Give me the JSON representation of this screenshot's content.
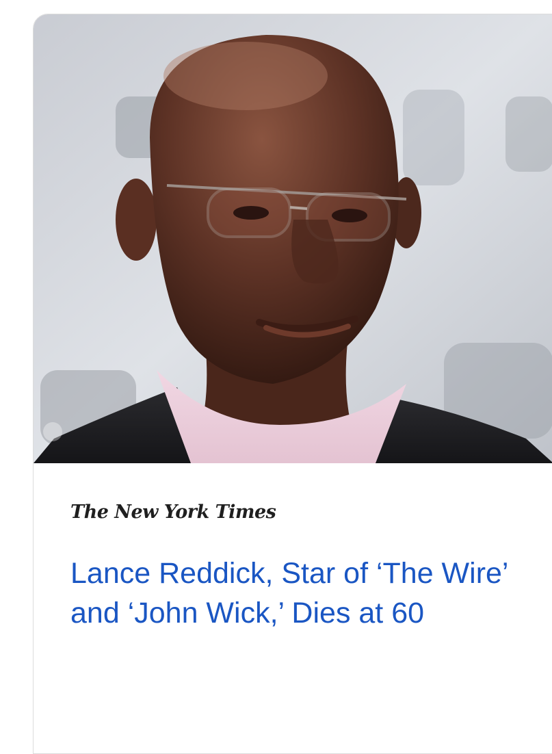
{
  "card": {
    "publisher": "The New York Times",
    "headline": "Lance Reddick, Star of ‘The Wire’ and ‘John Wick,’ Dies at 60",
    "image_icon": "portrait-photo"
  },
  "colors": {
    "headline": "#1a56c3",
    "publisher": "#1f1f1f",
    "card_border": "#dcdcdc"
  }
}
